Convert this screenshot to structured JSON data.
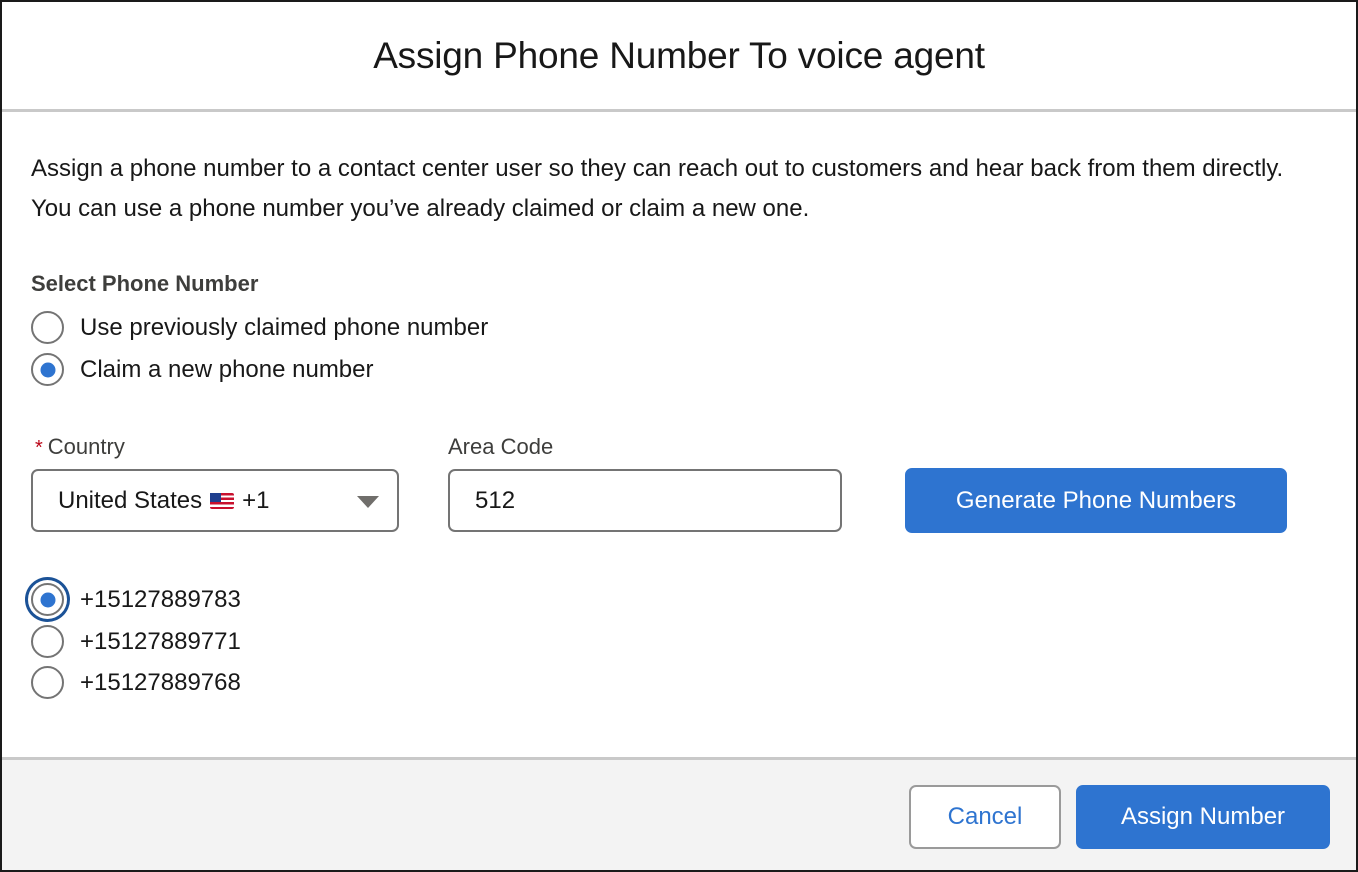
{
  "header": {
    "title": "Assign Phone Number To voice agent"
  },
  "body": {
    "intro": "Assign a phone number to a contact center user so they can reach out to customers and hear back from them directly. You can use a phone number you’ve already claimed or claim a new one.",
    "select_group": {
      "legend": "Select Phone Number",
      "options": [
        {
          "label": "Use previously claimed phone number",
          "checked": false
        },
        {
          "label": "Claim a new phone number",
          "checked": true
        }
      ]
    },
    "country": {
      "required_mark": "*",
      "label": "Country",
      "value_name": "United States",
      "value_code": "+1",
      "flag_icon": "us-flag-icon"
    },
    "area_code": {
      "label": "Area Code",
      "value": "512"
    },
    "generate_button": "Generate Phone Numbers",
    "numbers": [
      {
        "label": "+15127889783",
        "checked": true
      },
      {
        "label": "+15127889771",
        "checked": false
      },
      {
        "label": "+15127889768",
        "checked": false
      }
    ]
  },
  "footer": {
    "cancel_label": "Cancel",
    "assign_label": "Assign Number"
  },
  "colors": {
    "brand": "#2e74d0",
    "required": "#ba0517",
    "footer_bg": "#f3f3f3",
    "divider": "#c9c9c9"
  }
}
